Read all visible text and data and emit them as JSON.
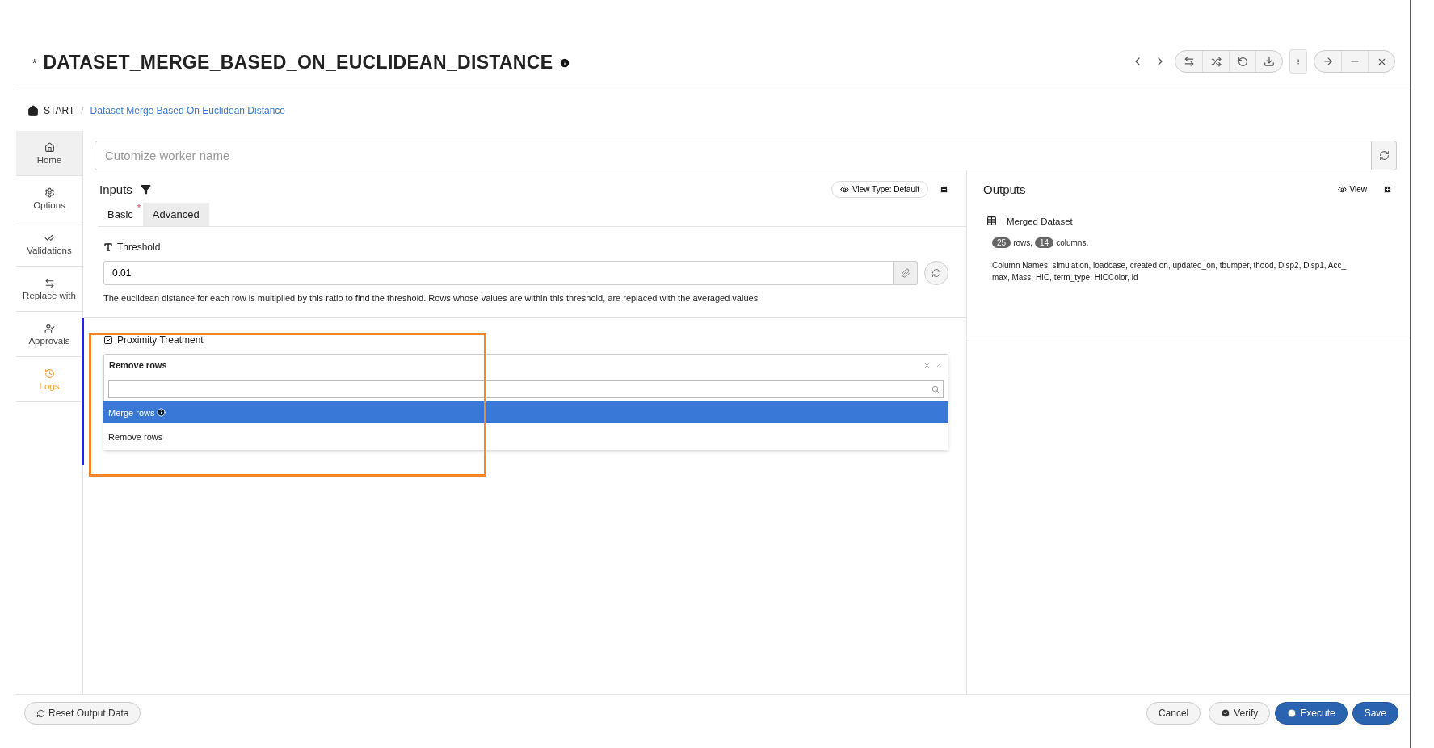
{
  "title_mark": "*",
  "title": "DATASET_MERGE_BASED_ON_EUCLIDEAN_DISTANCE",
  "breadcrumb": [
    {
      "label": "START",
      "kind": "home"
    },
    {
      "label": "/",
      "kind": "separator"
    },
    {
      "label": "Dataset Merge Based On Euclidean Distance",
      "kind": "link"
    }
  ],
  "sidebar": {
    "items": [
      {
        "label": "Home",
        "selected": true,
        "alert": false
      },
      {
        "label": "Options",
        "selected": false,
        "alert": false
      },
      {
        "label": "Validations",
        "selected": false,
        "alert": false
      },
      {
        "label": "Replace with",
        "selected": false,
        "alert": false
      },
      {
        "label": "Approvals",
        "selected": false,
        "alert": false
      },
      {
        "label": "Logs",
        "selected": false,
        "alert": true
      }
    ]
  },
  "worker_name": {
    "placeholder": "Cutomize worker name"
  },
  "inputs": {
    "title": "Inputs",
    "view_type": "View Type: Default",
    "tabs": [
      {
        "label": "Basic",
        "required": true,
        "selected": false
      },
      {
        "label": "Advanced",
        "required": false,
        "selected": true
      }
    ],
    "threshold": {
      "label": "Threshold",
      "value": "0.01",
      "help": "The euclidean distance for each row is multiplied by this ratio to find the threshold. Rows whose values are within this threshold, are replaced with the averaged values"
    },
    "proximity": {
      "label": "Proximity Treatment",
      "expanded": true,
      "value": "Remove rows",
      "open": true,
      "options": [
        {
          "label": "Merge rows",
          "highlighted": true
        },
        {
          "label": "Remove rows",
          "highlighted": false
        }
      ]
    }
  },
  "outputs": {
    "title": "Outputs",
    "view": "View",
    "dataset": {
      "name": "Merged Dataset",
      "rows": "25",
      "rows_label": "rows,",
      "columns": "14",
      "columns_label": "columns.",
      "column_names": "Column Names: simulation, loadcase, created on, updated_on, tbumper, thood, Disp2, Disp1, Acc_max, Mass, HIC, term_type, HICColor, id"
    }
  },
  "footer": {
    "reset": "Reset Output Data",
    "buttons": [
      {
        "label": "Cancel",
        "kind": "plain"
      },
      {
        "label": "Verify",
        "kind": "verify"
      },
      {
        "label": "Execute",
        "kind": "execute"
      },
      {
        "label": "Save",
        "kind": "primary"
      }
    ]
  }
}
